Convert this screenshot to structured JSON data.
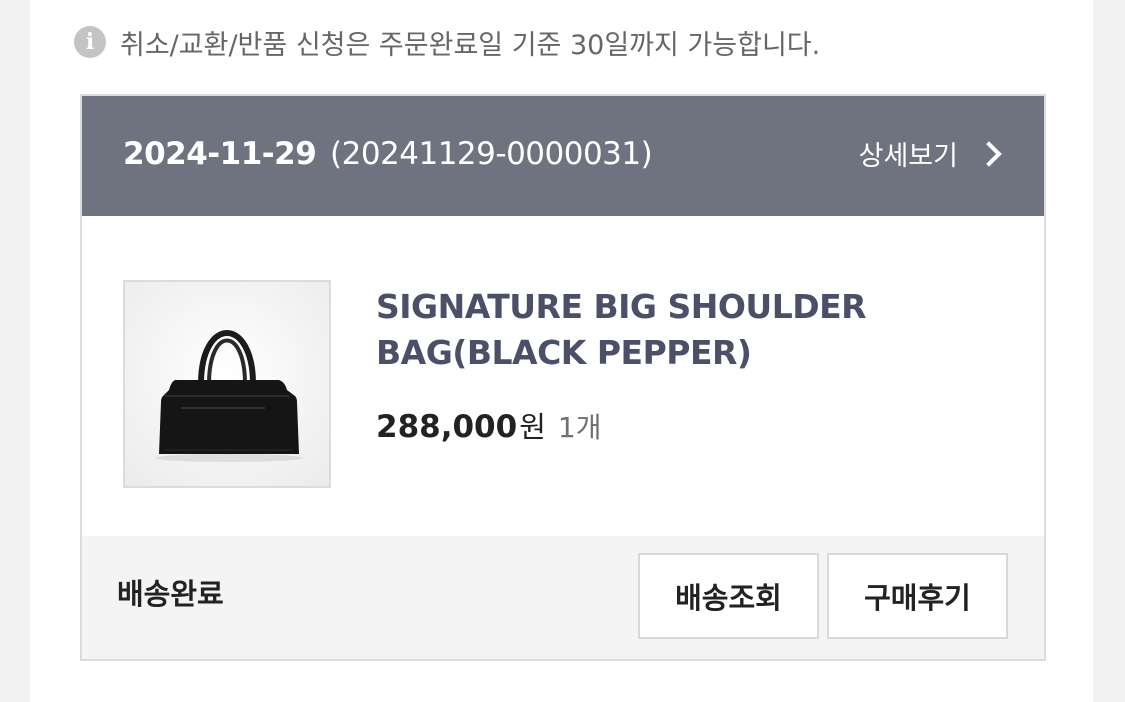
{
  "notice": {
    "icon": "info-icon",
    "icon_glyph": "i",
    "text": "취소/교환/반품 신청은 주문완료일 기준 30일까지 가능합니다."
  },
  "order": {
    "date": "2024-11-29",
    "order_number": "(20241129-0000031)",
    "detail_link": "상세보기",
    "product": {
      "name": "SIGNATURE BIG SHOULDER BAG(BLACK PEPPER)",
      "price": "288,000",
      "currency": "원",
      "quantity": "1개",
      "image_icon": "handbag-image"
    },
    "status": "배송완료",
    "buttons": {
      "tracking": "배송조회",
      "review": "구매후기"
    }
  },
  "colors": {
    "header_bg": "#6f7380",
    "product_name": "#4b5068",
    "footer_bg": "#f4f4f4"
  }
}
